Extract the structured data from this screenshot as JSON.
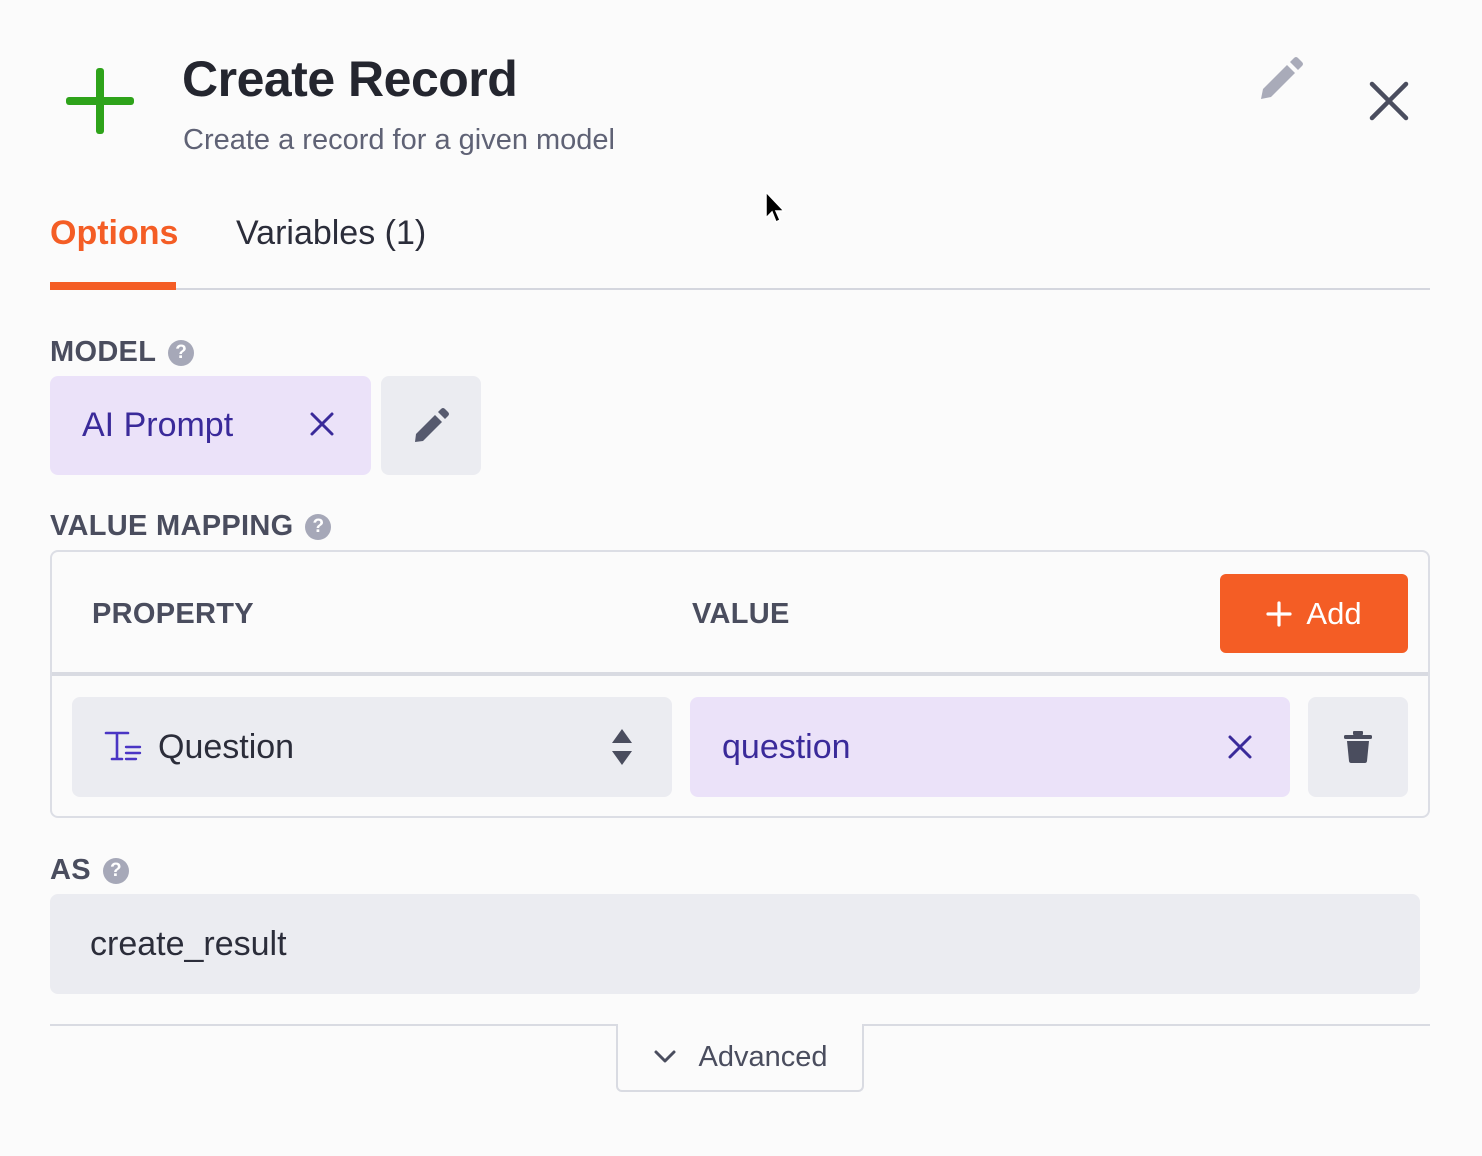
{
  "header": {
    "title": "Create Record",
    "subtitle": "Create a record for a given model",
    "icon": "plus-icon",
    "accent_color": "#2ea31a"
  },
  "tabs": [
    {
      "label": "Options",
      "active": true
    },
    {
      "label": "Variables (1)",
      "active": false
    }
  ],
  "model": {
    "label": "MODEL",
    "value": "AI Prompt"
  },
  "value_mapping": {
    "label": "VALUE MAPPING",
    "property_header": "PROPERTY",
    "value_header": "VALUE",
    "add_label": "Add",
    "rows": [
      {
        "property": "Question",
        "property_type_icon": "text-type-icon",
        "value": "question"
      }
    ]
  },
  "as": {
    "label": "AS",
    "value": "create_result"
  },
  "advanced": {
    "label": "Advanced"
  },
  "colors": {
    "primary": "#f45d25",
    "chip_bg": "#ebe2f9",
    "chip_text": "#3a2a9a"
  }
}
